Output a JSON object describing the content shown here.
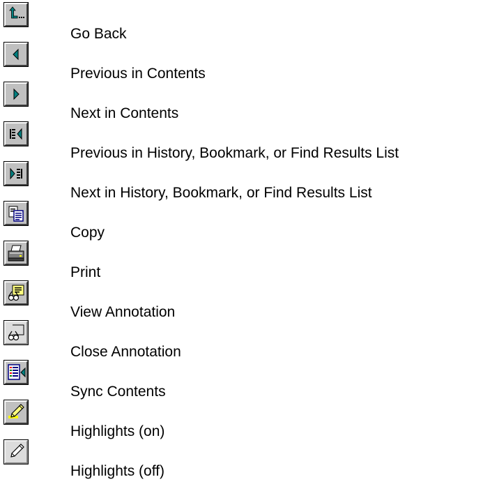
{
  "toolbar_legend": {
    "items": [
      {
        "icon": "go-back-icon",
        "label": "Go Back"
      },
      {
        "icon": "previous-in-contents-icon",
        "label": "Previous in Contents"
      },
      {
        "icon": "next-in-contents-icon",
        "label": "Next in Contents"
      },
      {
        "icon": "previous-in-history-icon",
        "label": "Previous in History, Bookmark, or Find Results List"
      },
      {
        "icon": "next-in-history-icon",
        "label": "Next in History, Bookmark, or Find Results List"
      },
      {
        "icon": "copy-icon",
        "label": "Copy"
      },
      {
        "icon": "print-icon",
        "label": "Print"
      },
      {
        "icon": "view-annotation-icon",
        "label": "View Annotation"
      },
      {
        "icon": "close-annotation-icon",
        "label": "Close Annotation"
      },
      {
        "icon": "sync-contents-icon",
        "label": "Sync Contents"
      },
      {
        "icon": "highlights-on-icon",
        "label": "Highlights (on)"
      },
      {
        "icon": "highlights-off-icon",
        "label": "Highlights (off)"
      }
    ]
  },
  "colors": {
    "button_face": "#c0c0c0",
    "arrow_teal": "#008080",
    "annotation_yellow": "#ffff80",
    "copy_blue": "#000080"
  }
}
